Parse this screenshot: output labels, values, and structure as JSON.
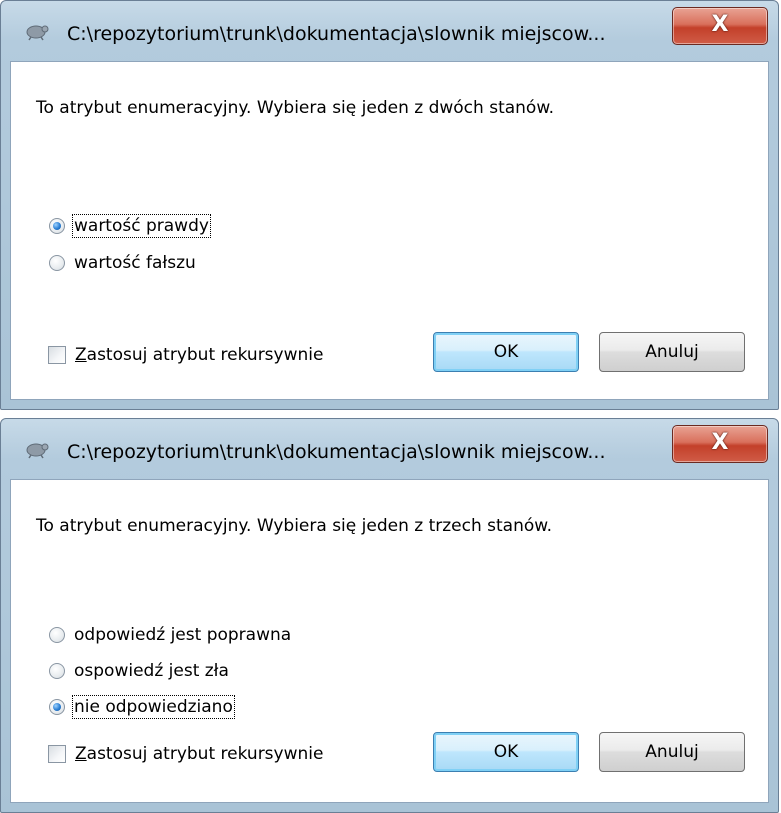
{
  "dialogs": [
    {
      "title": "C:\\repozytorium\\trunk\\dokumentacja\\slownik miejscow...",
      "close_label": "X",
      "description": "To atrybut enumeracyjny. Wybiera się jeden z dwóch stanów.",
      "options": [
        {
          "label": "wartość prawdy",
          "checked": true
        },
        {
          "label": "wartość fałszu",
          "checked": false
        }
      ],
      "checkbox": {
        "mnemonic": "Z",
        "label_rest": "astosuj atrybut rekursywnie",
        "checked": false
      },
      "ok_label": "OK",
      "cancel_label": "Anuluj"
    },
    {
      "title": "C:\\repozytorium\\trunk\\dokumentacja\\slownik miejscow...",
      "close_label": "X",
      "description": "To atrybut enumeracyjny. Wybiera się jeden z trzech stanów.",
      "options": [
        {
          "label": "odpowiedź jest poprawna",
          "checked": false
        },
        {
          "label": "ospowiedź jest zła",
          "checked": false
        },
        {
          "label": "nie odpowiedziano",
          "checked": true
        }
      ],
      "checkbox": {
        "mnemonic": "Z",
        "label_rest": "astosuj atrybut rekursywnie",
        "checked": false
      },
      "ok_label": "OK",
      "cancel_label": "Anuluj"
    }
  ]
}
